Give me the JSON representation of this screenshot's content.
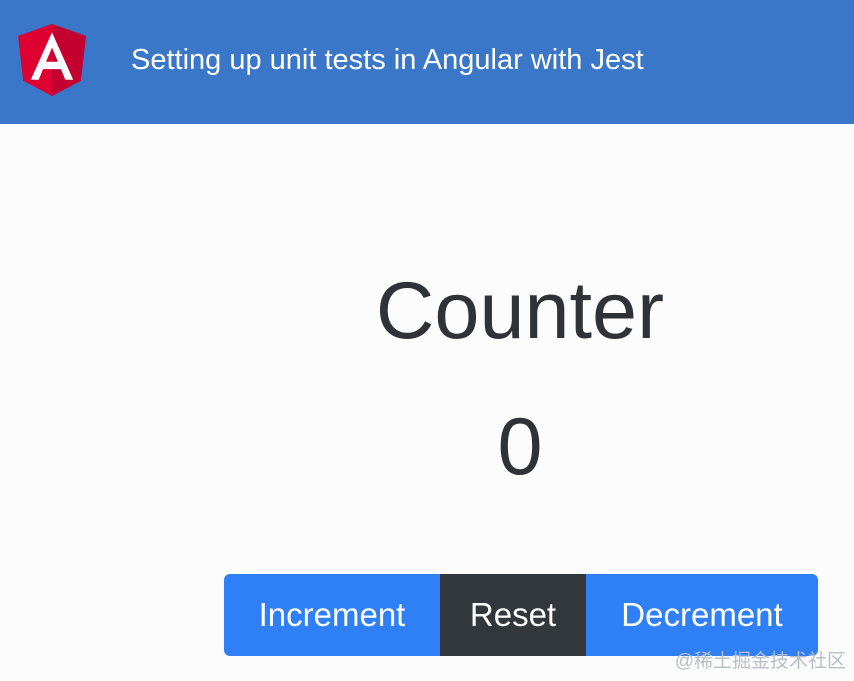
{
  "toolbar": {
    "logo_icon": "angular-logo-icon",
    "title": "Setting up unit tests in Angular with Jest",
    "background": "#3b77c9"
  },
  "counter": {
    "title": "Counter",
    "value": "0"
  },
  "buttons": {
    "increment_label": "Increment",
    "reset_label": "Reset",
    "decrement_label": "Decrement",
    "primary_color": "#2f80f7",
    "dark_color": "#32373c"
  },
  "watermark": "@稀土掘金技术社区"
}
